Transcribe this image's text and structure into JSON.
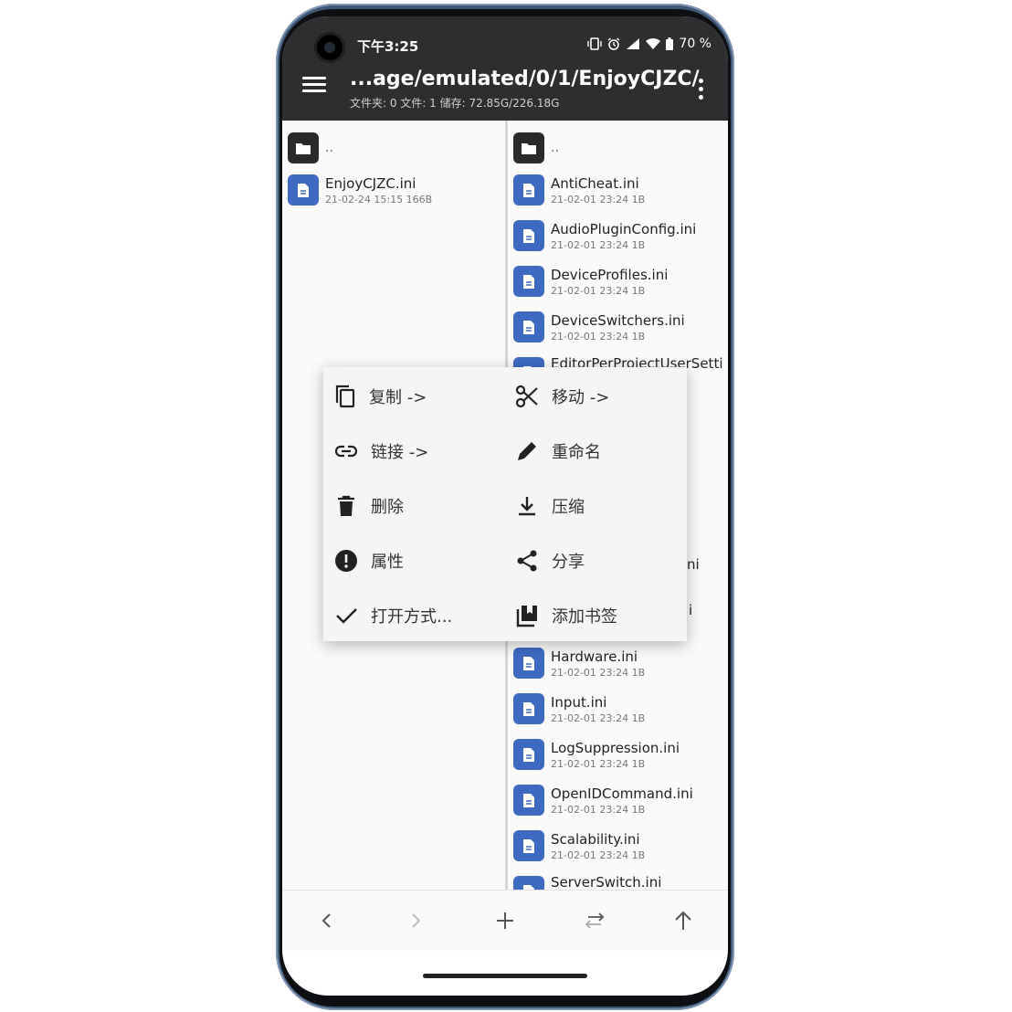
{
  "status_bar": {
    "time": "下午3:25",
    "battery": "70 %"
  },
  "toolbar": {
    "path": "...age/emulated/0/1/EnjoyCJZC/",
    "stats": "文件夹: 0   文件: 1   储存: 72.85G/226.18G"
  },
  "left_pane": {
    "parent": "..",
    "files": [
      {
        "name": "EnjoyCJZC.ini",
        "meta": "21-02-24 15:15  166B"
      }
    ]
  },
  "right_pane": {
    "parent": "..",
    "files_top": [
      {
        "name": "AntiCheat.ini",
        "meta": "21-02-01 23:24  1B"
      },
      {
        "name": "AudioPluginConfig.ini",
        "meta": "21-02-01 23:24  1B"
      },
      {
        "name": "DeviceProfiles.ini",
        "meta": "21-02-01 23:24  1B"
      },
      {
        "name": "DeviceSwitchers.ini",
        "meta": "21-02-01 23:24  1B"
      },
      {
        "name": "EditorPerProjectUserSetti"
      }
    ],
    "partial_right": [
      "ni",
      "i"
    ],
    "files_bottom": [
      {
        "name": "Hardware.ini",
        "meta": "21-02-01 23:24  1B"
      },
      {
        "name": "Input.ini",
        "meta": "21-02-01 23:24  1B"
      },
      {
        "name": "LogSuppression.ini",
        "meta": "21-02-01 23:24  1B"
      },
      {
        "name": "OpenIDCommand.ini",
        "meta": "21-02-01 23:24  1B"
      },
      {
        "name": "Scalability.ini",
        "meta": "21-02-01 23:24  1B"
      },
      {
        "name": "ServerSwitch.ini"
      }
    ]
  },
  "context_menu": {
    "copy": "复制 ->",
    "move": "移动 ->",
    "link": "链接 ->",
    "rename": "重命名",
    "delete": "删除",
    "compress": "压缩",
    "properties": "属性",
    "share": "分享",
    "open_with": "打开方式...",
    "bookmark": "添加书签"
  },
  "icons": {
    "menu": "hamburger-icon",
    "more": "kebab-icon",
    "back": "chevron-left-icon",
    "forward": "chevron-right-icon",
    "add": "plus-icon",
    "swap": "swap-icon",
    "up": "arrow-up-icon"
  },
  "colors": {
    "toolbar": "#2e2e30",
    "file_icon": "#3f6ac2",
    "folder_icon": "#2a2a2a",
    "frame": "#3e5777"
  }
}
